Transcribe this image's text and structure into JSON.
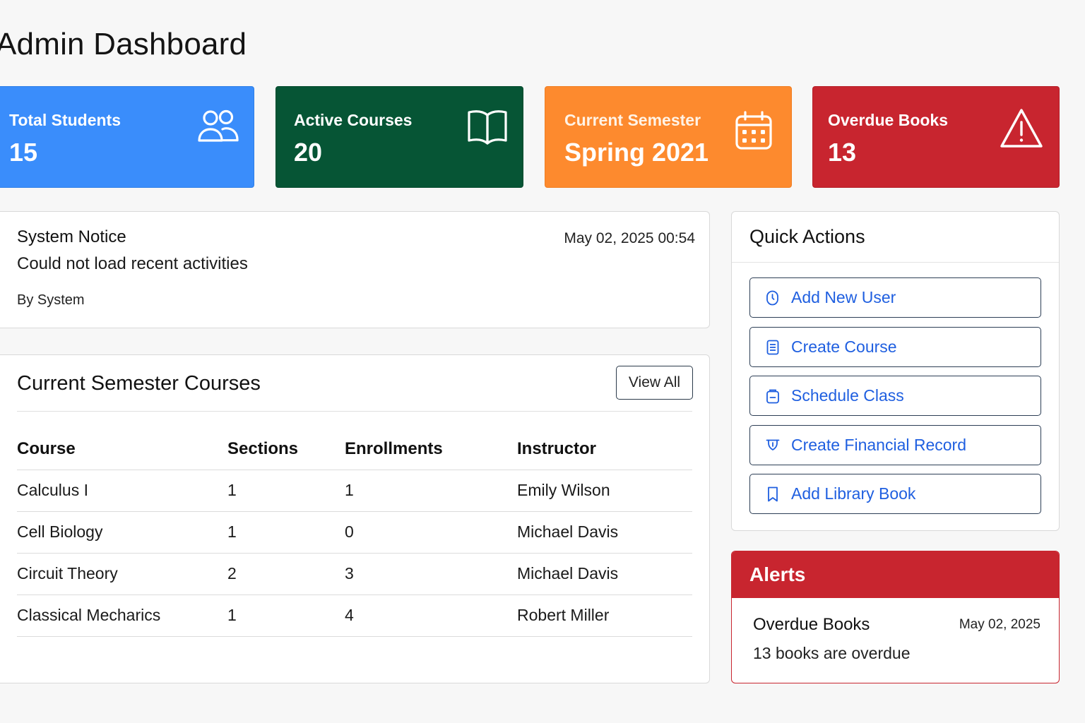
{
  "page": {
    "title": "Admin Dashboard"
  },
  "stats": [
    {
      "label": "Total Students",
      "value": "15",
      "icon": "users-icon",
      "color": "#3a8dfb"
    },
    {
      "label": "Active Courses",
      "value": "20",
      "icon": "book-icon",
      "color": "#065535"
    },
    {
      "label": "Current Semester",
      "value": "Spring 2021",
      "icon": "calendar-icon",
      "color": "#fd8a2e"
    },
    {
      "label": "Overdue Books",
      "value": "13",
      "icon": "warning-icon",
      "color": "#c8252f"
    }
  ],
  "notice": {
    "title": "System Notice",
    "date": "May 02, 2025 00:54",
    "message": "Could not load recent activities",
    "by": "By System"
  },
  "courses": {
    "title": "Current Semester Courses",
    "view_all": "View All",
    "columns": [
      "Course",
      "Sections",
      "Enrollments",
      "Instructor"
    ],
    "rows": [
      [
        "Calculus I",
        "1",
        "1",
        "Emily Wilson"
      ],
      [
        "Cell Biology",
        "1",
        "0",
        "Michael Davis"
      ],
      [
        "Circuit Theory",
        "2",
        "3",
        "Michael Davis"
      ],
      [
        "Classical Mecharics",
        "1",
        "4",
        "Robert Miller"
      ]
    ]
  },
  "quick_actions": {
    "title": "Quick Actions",
    "items": [
      {
        "label": "Add New User",
        "icon": "user-add-icon"
      },
      {
        "label": "Create Course",
        "icon": "document-icon"
      },
      {
        "label": "Schedule Class",
        "icon": "schedule-icon"
      },
      {
        "label": "Create Financial Record",
        "icon": "finance-icon"
      },
      {
        "label": "Add Library Book",
        "icon": "bookmark-icon"
      }
    ]
  },
  "alerts": {
    "title": "Alerts",
    "items": [
      {
        "title": "Overdue Books",
        "date": "May 02, 2025",
        "message": "13 books are overdue"
      }
    ]
  },
  "colors": {
    "accent_link": "#1f5fe0",
    "danger": "#c8252f"
  }
}
